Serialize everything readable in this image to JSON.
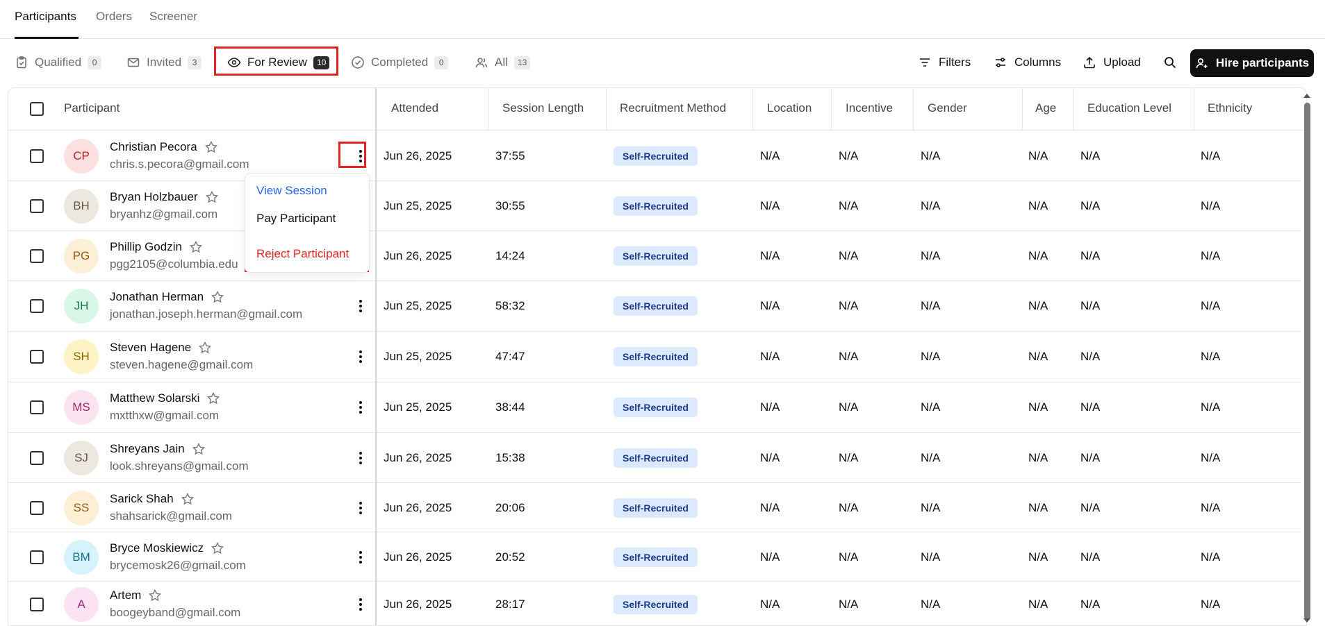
{
  "top_tabs": [
    {
      "label": "Participants",
      "active": true
    },
    {
      "label": "Orders",
      "active": false
    },
    {
      "label": "Screener",
      "active": false
    }
  ],
  "filters": [
    {
      "label": "Qualified",
      "count": "0",
      "icon": "clipboard-check-icon"
    },
    {
      "label": "Invited",
      "count": "3",
      "icon": "mail-icon"
    },
    {
      "label": "For Review",
      "count": "10",
      "icon": "eye-icon",
      "active": true
    },
    {
      "label": "Completed",
      "count": "0",
      "icon": "check-circle-icon"
    },
    {
      "label": "All",
      "count": "13",
      "icon": "users-icon"
    }
  ],
  "toolbar": {
    "filters_label": "Filters",
    "columns_label": "Columns",
    "upload_label": "Upload",
    "hire_label": "Hire participants"
  },
  "columns": [
    "Participant",
    "Attended",
    "Session Length",
    "Recruitment Method",
    "Location",
    "Incentive",
    "Gender",
    "Age",
    "Education Level",
    "Ethnicity"
  ],
  "rows": [
    {
      "initials": "CP",
      "name": "Christian Pecora",
      "email": "chris.s.pecora@gmail.com",
      "attended": "Jun 26, 2025",
      "session_length": "37:55",
      "method": "Self-Recruited",
      "location": "N/A",
      "incentive": "N/A",
      "gender": "N/A",
      "age": "N/A",
      "education": "N/A",
      "ethnicity": "N/A",
      "avatar_bg": "#fde0e0",
      "avatar_fg": "#b42323"
    },
    {
      "initials": "BH",
      "name": "Bryan Holzbauer",
      "email": "bryanhz@gmail.com",
      "attended": "Jun 25, 2025",
      "session_length": "30:55",
      "method": "Self-Recruited",
      "location": "N/A",
      "incentive": "N/A",
      "gender": "N/A",
      "age": "N/A",
      "education": "N/A",
      "ethnicity": "N/A",
      "avatar_bg": "#ede8df",
      "avatar_fg": "#6b5a45"
    },
    {
      "initials": "PG",
      "name": "Phillip Godzin",
      "email": "pgg2105@columbia.edu",
      "attended": "Jun 26, 2025",
      "session_length": "14:24",
      "method": "Self-Recruited",
      "location": "N/A",
      "incentive": "N/A",
      "gender": "N/A",
      "age": "N/A",
      "education": "N/A",
      "ethnicity": "N/A",
      "avatar_bg": "#fdefd6",
      "avatar_fg": "#9a5a10"
    },
    {
      "initials": "JH",
      "name": "Jonathan Herman",
      "email": "jonathan.joseph.herman@gmail.com",
      "attended": "Jun 25, 2025",
      "session_length": "58:32",
      "method": "Self-Recruited",
      "location": "N/A",
      "incentive": "N/A",
      "gender": "N/A",
      "age": "N/A",
      "education": "N/A",
      "ethnicity": "N/A",
      "avatar_bg": "#d9f7e8",
      "avatar_fg": "#1e7a4c"
    },
    {
      "initials": "SH",
      "name": "Steven Hagene",
      "email": "steven.hagene@gmail.com",
      "attended": "Jun 25, 2025",
      "session_length": "47:47",
      "method": "Self-Recruited",
      "location": "N/A",
      "incentive": "N/A",
      "gender": "N/A",
      "age": "N/A",
      "education": "N/A",
      "ethnicity": "N/A",
      "avatar_bg": "#fdf3c4",
      "avatar_fg": "#8a6b00"
    },
    {
      "initials": "MS",
      "name": "Matthew Solarski",
      "email": "mxtthxw@gmail.com",
      "attended": "Jun 25, 2025",
      "session_length": "38:44",
      "method": "Self-Recruited",
      "location": "N/A",
      "incentive": "N/A",
      "gender": "N/A",
      "age": "N/A",
      "education": "N/A",
      "ethnicity": "N/A",
      "avatar_bg": "#fbe3ef",
      "avatar_fg": "#9c2a63"
    },
    {
      "initials": "SJ",
      "name": "Shreyans Jain",
      "email": "look.shreyans@gmail.com",
      "attended": "Jun 26, 2025",
      "session_length": "15:38",
      "method": "Self-Recruited",
      "location": "N/A",
      "incentive": "N/A",
      "gender": "N/A",
      "age": "N/A",
      "education": "N/A",
      "ethnicity": "N/A",
      "avatar_bg": "#ede8df",
      "avatar_fg": "#6b5a45"
    },
    {
      "initials": "SS",
      "name": "Sarick Shah",
      "email": "shahsarick@gmail.com",
      "attended": "Jun 26, 2025",
      "session_length": "20:06",
      "method": "Self-Recruited",
      "location": "N/A",
      "incentive": "N/A",
      "gender": "N/A",
      "age": "N/A",
      "education": "N/A",
      "ethnicity": "N/A",
      "avatar_bg": "#fdefd6",
      "avatar_fg": "#9a5a10"
    },
    {
      "initials": "BM",
      "name": "Bryce Moskiewicz",
      "email": "brycemosk26@gmail.com",
      "attended": "Jun 26, 2025",
      "session_length": "20:52",
      "method": "Self-Recruited",
      "location": "N/A",
      "incentive": "N/A",
      "gender": "N/A",
      "age": "N/A",
      "education": "N/A",
      "ethnicity": "N/A",
      "avatar_bg": "#d6f3fb",
      "avatar_fg": "#1b6f86"
    },
    {
      "initials": "A",
      "name": "Artem",
      "email": "boogeyband@gmail.com",
      "attended": "Jun 26, 2025",
      "session_length": "28:17",
      "method": "Self-Recruited",
      "location": "N/A",
      "incentive": "N/A",
      "gender": "N/A",
      "age": "N/A",
      "education": "N/A",
      "ethnicity": "N/A",
      "avatar_bg": "#fbe3f3",
      "avatar_fg": "#9c2a7a"
    }
  ],
  "row_menu": {
    "view_session": "View Session",
    "pay_participant": "Pay Participant",
    "reject_participant": "Reject Participant"
  },
  "colors": {
    "highlight": "#e02424",
    "link_blue": "#2563eb",
    "badge_bg": "#dbeafe",
    "badge_fg": "#1e3a8a"
  }
}
